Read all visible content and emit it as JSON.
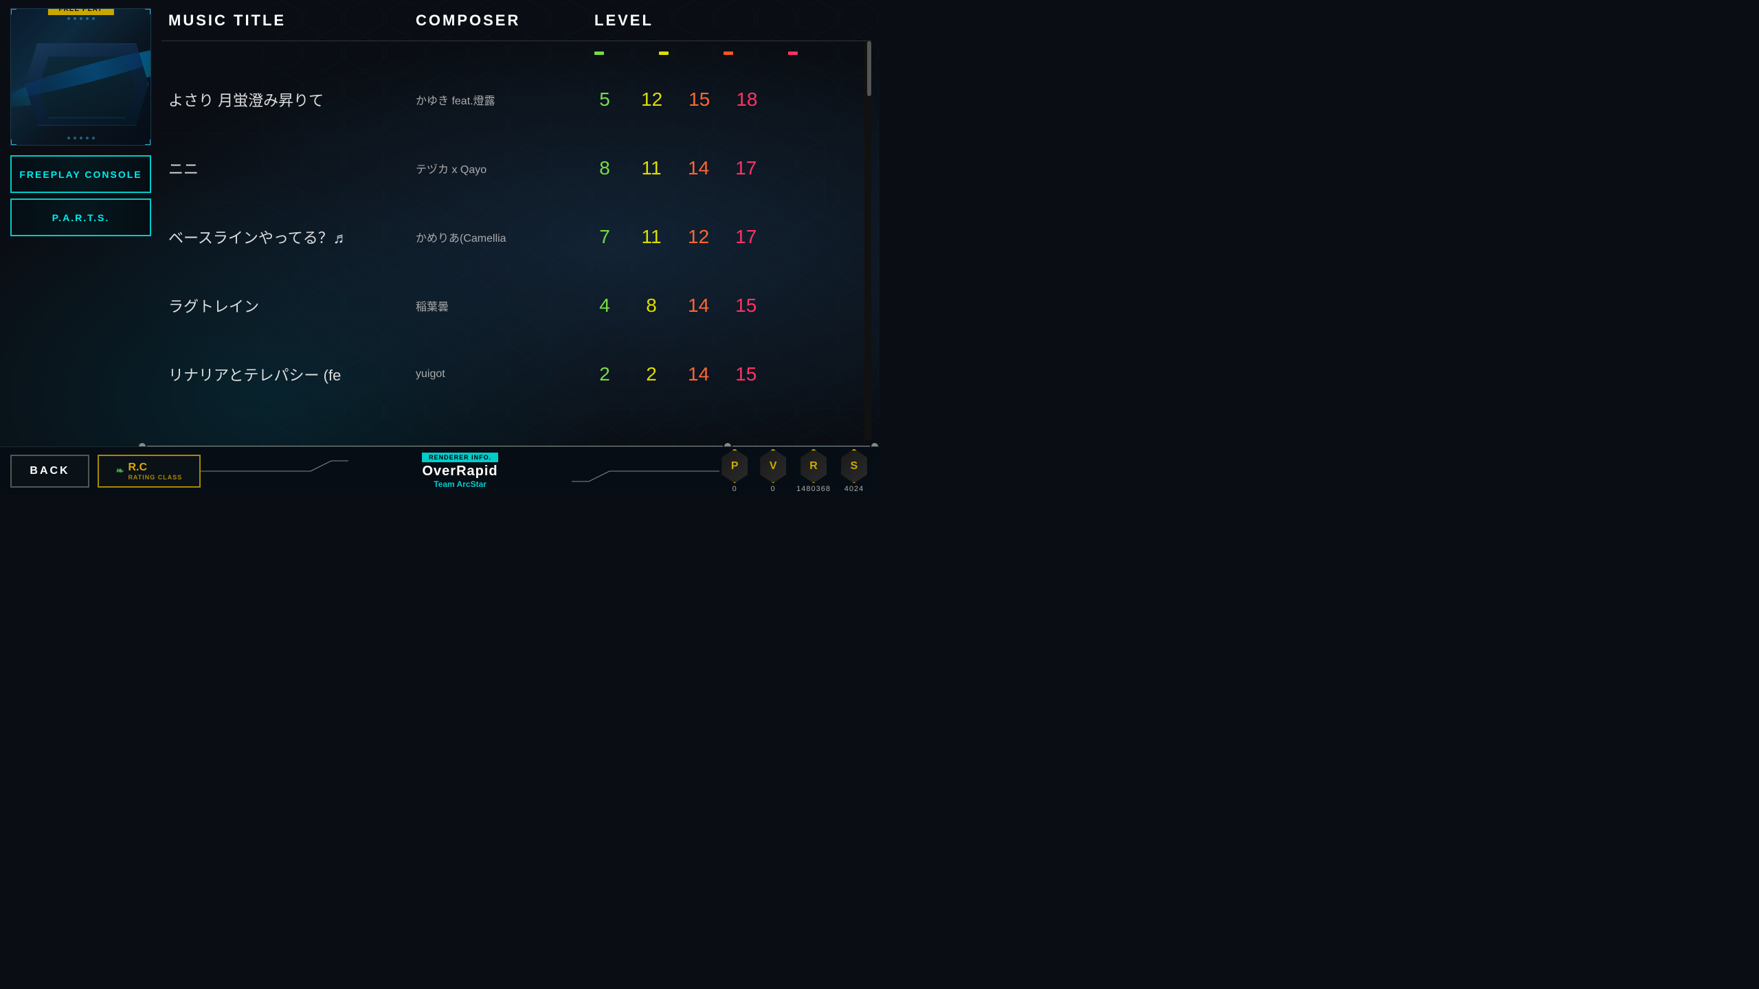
{
  "app": {
    "title": "OverRapid",
    "team": "Team ArcStar",
    "renderer_badge": "RENDERER INFO."
  },
  "left_panel": {
    "free_play_label": "FREE PLAY",
    "buttons": [
      {
        "id": "freeplay-console",
        "label": "FREEPLAY CONSOLE"
      },
      {
        "id": "parts",
        "label": "P.A.R.T.S."
      }
    ]
  },
  "table": {
    "headers": {
      "music_title": "MUSIC TITLE",
      "composer": "COMPOSER",
      "level": "LEVEL"
    },
    "level_colors": [
      "#77dd44",
      "#dddd44",
      "#ff5522",
      "#ff3366"
    ],
    "rows": [
      {
        "title": "よさり 月蛍澄み昇りて",
        "composer": "かゆき feat.燈露",
        "levels": [
          5,
          12,
          15,
          18
        ]
      },
      {
        "title": "ニニ",
        "composer": "テヅカ x Qayo",
        "levels": [
          8,
          11,
          14,
          17
        ]
      },
      {
        "title": "ベースラインやってる？♬",
        "composer": "かめりあ(Camellia",
        "levels": [
          7,
          11,
          12,
          17
        ]
      },
      {
        "title": "ラグトレイン",
        "composer": "稲葉曇",
        "levels": [
          4,
          8,
          14,
          15
        ]
      },
      {
        "title": "リナリアとテレパシー (fe",
        "composer": "yuigot",
        "levels": [
          2,
          2,
          14,
          15
        ]
      }
    ]
  },
  "bottom_bar": {
    "back_label": "BACK",
    "rating": {
      "rc_label": "R.C",
      "rating_class_label": "RATING CLASS"
    },
    "scores": [
      {
        "id": "P",
        "value": "0"
      },
      {
        "id": "V",
        "value": "0"
      },
      {
        "id": "R",
        "value": "1480368"
      },
      {
        "id": "S",
        "value": "4024"
      }
    ]
  }
}
